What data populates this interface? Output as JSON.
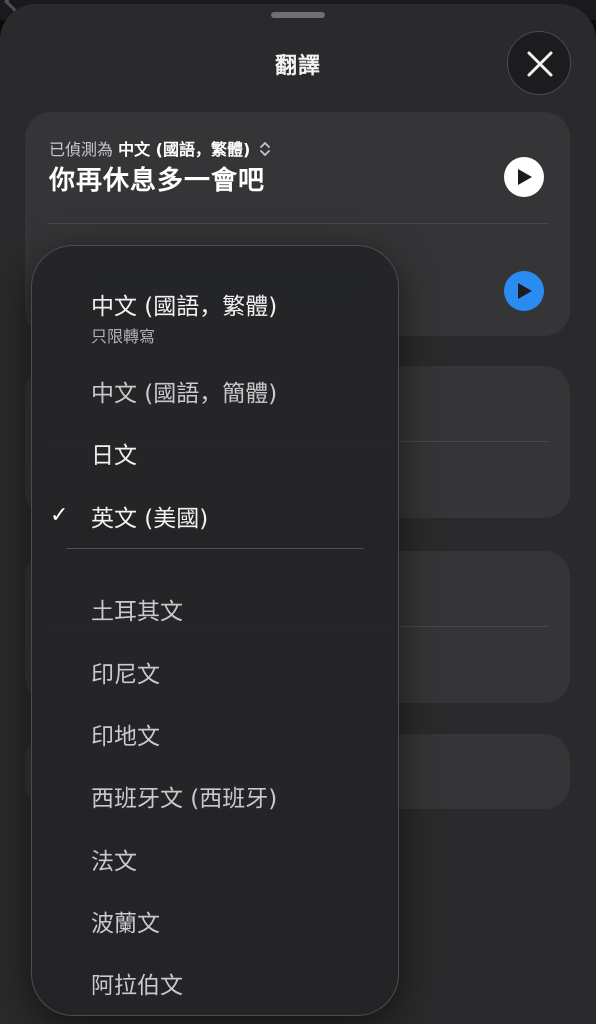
{
  "sheet": {
    "title": "翻譯"
  },
  "source": {
    "detected_prefix": "已偵測為",
    "detected_language": "中文 (國語，繁體)",
    "text": "你再休息多一會吧"
  },
  "menu": {
    "items": [
      {
        "label": "中文 (國語，繁體)",
        "sub": "只限轉寫",
        "checked": false
      },
      {
        "label": "中文 (國語，簡體)",
        "checked": false
      },
      {
        "label": "日文",
        "checked": false
      },
      {
        "label": "英文 (美國)",
        "checked": true
      },
      {
        "label": "土耳其文",
        "checked": false
      },
      {
        "label": "印尼文",
        "checked": false
      },
      {
        "label": "印地文",
        "checked": false
      },
      {
        "label": "西班牙文 (西班牙)",
        "checked": false
      },
      {
        "label": "法文",
        "checked": false
      },
      {
        "label": "波蘭文",
        "checked": false
      },
      {
        "label": "阿拉伯文",
        "checked": false
      }
    ],
    "check_glyph": "✓"
  },
  "colors": {
    "accent_blue": "#2a8cf0",
    "sheet_bg": "#2a2a2c",
    "card_bg": "#353537"
  },
  "icons": [
    "close-icon",
    "chevron-up-down-icon",
    "play-icon",
    "checkmark-icon"
  ]
}
